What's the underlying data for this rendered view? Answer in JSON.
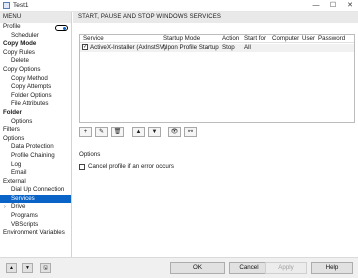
{
  "window": {
    "title": "Test1",
    "minimize": "—",
    "maximize": "☐",
    "close": "✕"
  },
  "sidebar": {
    "header": "MENU",
    "items": [
      {
        "label": "Profile",
        "level": 0,
        "bold": false
      },
      {
        "label": "Scheduler",
        "level": 1,
        "bold": false
      },
      {
        "label": "Copy Mode",
        "level": 0,
        "bold": true
      },
      {
        "label": "Copy Rules",
        "level": 0,
        "bold": false
      },
      {
        "label": "Delete",
        "level": 1,
        "bold": false
      },
      {
        "label": "Copy Options",
        "level": 0,
        "bold": false
      },
      {
        "label": "Copy Method",
        "level": 1,
        "bold": false
      },
      {
        "label": "Copy Attempts",
        "level": 1,
        "bold": false
      },
      {
        "label": "Folder Options",
        "level": 1,
        "bold": false
      },
      {
        "label": "File Attributes",
        "level": 1,
        "bold": false
      },
      {
        "label": "Folder",
        "level": 0,
        "bold": true
      },
      {
        "label": "Options",
        "level": 1,
        "bold": false
      },
      {
        "label": "Filters",
        "level": 0,
        "bold": false
      },
      {
        "label": "Options",
        "level": 0,
        "bold": false
      },
      {
        "label": "Data Protection",
        "level": 1,
        "bold": false
      },
      {
        "label": "Profile Chaining",
        "level": 1,
        "bold": false
      },
      {
        "label": "Log",
        "level": 1,
        "bold": false
      },
      {
        "label": "Email",
        "level": 1,
        "bold": false
      },
      {
        "label": "External",
        "level": 0,
        "bold": false
      },
      {
        "label": "Dial Up Connection",
        "level": 1,
        "bold": false
      },
      {
        "label": "Services",
        "level": 1,
        "bold": false,
        "selected": true
      },
      {
        "label": "Drive",
        "level": 1,
        "bold": false,
        "expander": "›"
      },
      {
        "label": "Programs",
        "level": 1,
        "bold": false
      },
      {
        "label": "VBScripts",
        "level": 1,
        "bold": false
      },
      {
        "label": "Environment Variables",
        "level": 0,
        "bold": false
      }
    ]
  },
  "main": {
    "header": "START, PAUSE AND STOP WINDOWS SERVICES",
    "table": {
      "columns": [
        "Service",
        "Startup Mode",
        "Action",
        "Start for",
        "Computer",
        "User",
        "Password"
      ],
      "rows": [
        {
          "checked": true,
          "service": "ActiveX-Installer (AxInstSV)",
          "startup_mode": "Upon Profile Startup",
          "action": "Stop",
          "start_for": "All",
          "computer": "",
          "user": "",
          "password": ""
        }
      ]
    },
    "toolbar": [
      {
        "name": "add-button",
        "icon": "+"
      },
      {
        "name": "edit-button",
        "icon": "✎"
      },
      {
        "name": "delete-button",
        "icon": "🗑"
      },
      {
        "name": "move-up-button",
        "icon": "▲"
      },
      {
        "name": "move-down-button",
        "icon": "▼"
      },
      {
        "name": "view-button",
        "icon": "👁"
      },
      {
        "name": "link-button",
        "icon": "⚯"
      }
    ],
    "options": {
      "title": "Options",
      "cancel_on_error_label": "Cancel profile if an error occurs",
      "cancel_on_error_checked": false
    }
  },
  "bottom": {
    "ok": "OK",
    "cancel": "Cancel",
    "apply": "Apply",
    "help": "Help",
    "up_icon": "▲",
    "down_icon": "▼",
    "save_icon": "🖫"
  },
  "colors": {
    "selection": "#0a64c8",
    "header_bg": "#e9e9e9"
  }
}
